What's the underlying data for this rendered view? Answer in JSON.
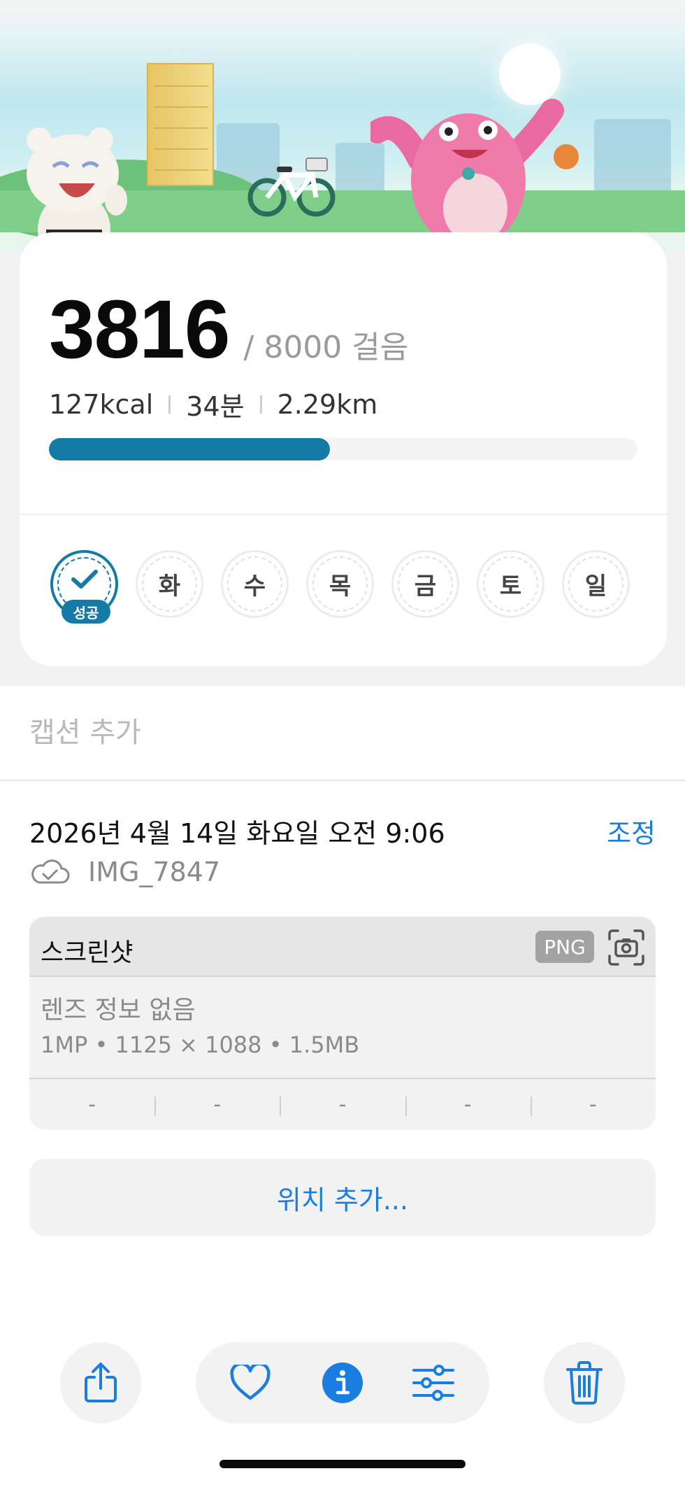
{
  "screenshot": {
    "steps": "3816",
    "goal_text": "/ 8000 걸음",
    "stats": {
      "calories": "127kcal",
      "minutes": "34분",
      "distance": "2.29km"
    },
    "progress_fraction": 0.477,
    "days": [
      {
        "label": "",
        "done": true,
        "badge": "성공"
      },
      {
        "label": "화",
        "done": false
      },
      {
        "label": "수",
        "done": false
      },
      {
        "label": "목",
        "done": false
      },
      {
        "label": "금",
        "done": false
      },
      {
        "label": "토",
        "done": false
      },
      {
        "label": "일",
        "done": false
      }
    ],
    "accent_color": "#137ba5"
  },
  "info": {
    "caption_placeholder": "캡션 추가",
    "datetime": "2026년 4월 14일 화요일 오전 9:06",
    "adjust_label": "조정",
    "filename": "IMG_7847",
    "meta": {
      "title": "스크린샷",
      "format_badge": "PNG",
      "lens": "렌즈 정보 없음",
      "specs": "1MP • 1125 × 1088 • 1.5MB",
      "exif": [
        "-",
        "-",
        "-",
        "-",
        "-"
      ]
    },
    "location_label": "위치 추가..."
  },
  "toolbar": {
    "icons": [
      "share-icon",
      "heart-icon",
      "info-icon",
      "adjust-sliders-icon",
      "trash-icon"
    ],
    "accent_color": "#1a7de0"
  }
}
